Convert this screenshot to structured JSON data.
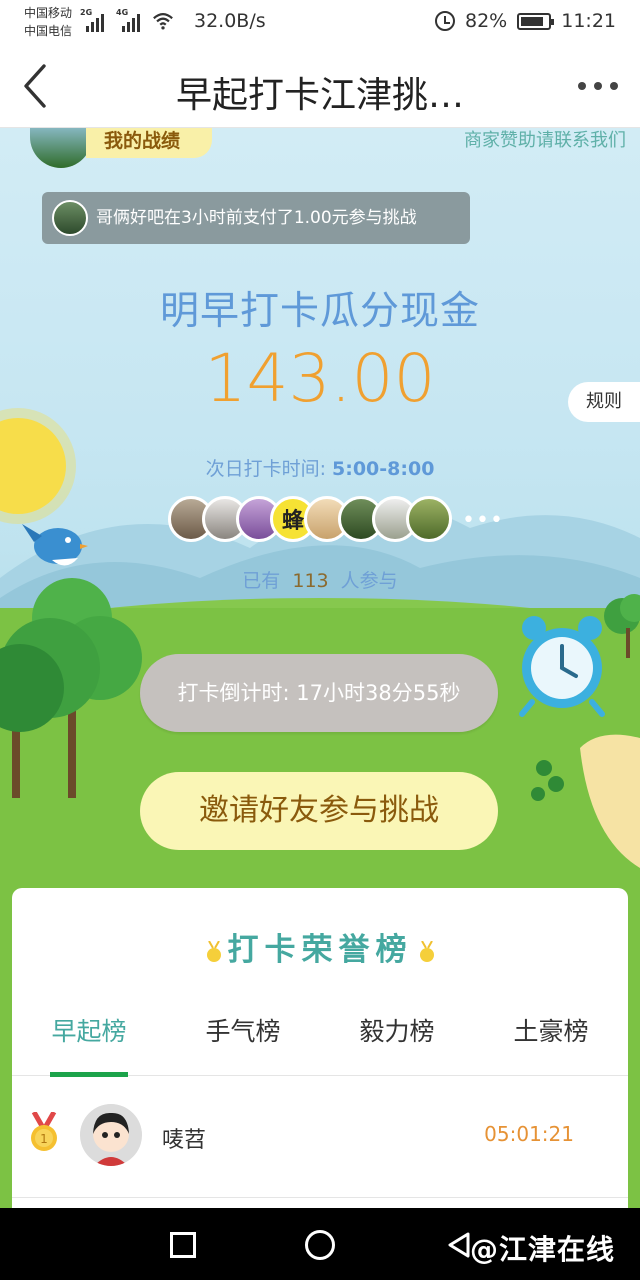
{
  "status_bar": {
    "carrier_1": "中国移动",
    "carrier_2": "中国电信",
    "net_badge_1": "2G",
    "net_badge_2": "4G",
    "net_speed": "32.0B/s",
    "battery": "82%",
    "battery_level": 0.82,
    "time": "11:21"
  },
  "nav": {
    "title": "早起打卡江津挑…",
    "back_icon": "chevron-left-icon",
    "more_icon": "more-dots-icon"
  },
  "header": {
    "my_record": "我的战绩",
    "sponsor": "商家赞助请联系我们"
  },
  "notice": {
    "text": "哥俩好吧在3小时前支付了1.00元参与挑战"
  },
  "pool": {
    "title": "明早打卡瓜分现金",
    "amount": "143.00",
    "rules": "规则"
  },
  "checkin": {
    "label": "次日打卡时间:",
    "window": "5:00-8:00"
  },
  "participants": {
    "bee_avatar_text": "蜂",
    "more": "•••",
    "prefix": "已有",
    "count": "113",
    "suffix": "人参与"
  },
  "countdown": {
    "text": "打卡倒计时: 17小时38分55秒"
  },
  "invite": {
    "text": "邀请好友参与挑战"
  },
  "board": {
    "title": "打卡荣誉榜",
    "tabs": [
      "早起榜",
      "手气榜",
      "毅力榜",
      "土豪榜"
    ],
    "active_tab": 0,
    "rows": [
      {
        "rank": "1",
        "name": "唛苕",
        "time": "05:01:21"
      }
    ]
  },
  "system_nav": {
    "watermark": "@江津在线"
  },
  "colors": {
    "accent_blue": "#5f99d8",
    "amount_orange": "#f0a030",
    "teal": "#45a8a0",
    "tab_underline": "#1ca34a",
    "grass": "#7cc244"
  }
}
